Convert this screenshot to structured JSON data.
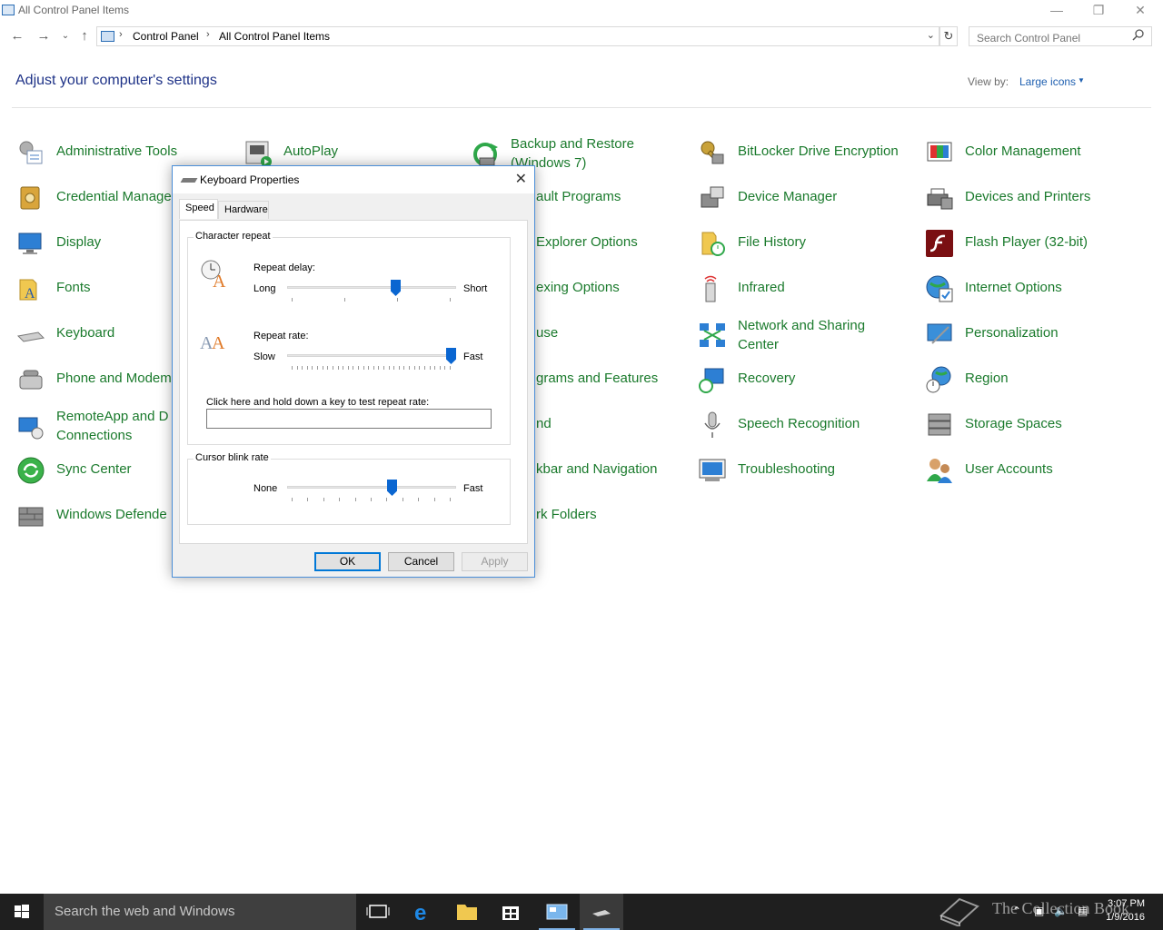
{
  "window": {
    "title": "All Control Panel Items"
  },
  "address": {
    "crumbs": [
      "Control Panel",
      "All Control Panel Items"
    ],
    "search_placeholder": "Search Control Panel"
  },
  "header": {
    "title": "Adjust your computer's settings",
    "view_by_label": "View by:",
    "view_by_value": "Large icons"
  },
  "items": [
    [
      "Administrative Tools",
      "AutoPlay",
      "Backup and Restore\n(Windows 7)",
      "BitLocker Drive Encryption",
      "Color Management"
    ],
    [
      "Credential Manager",
      "ault Programs",
      "Device Manager",
      "Devices and Printers"
    ],
    [
      "Display",
      "Explorer Options",
      "File History",
      "Flash Player (32-bit)"
    ],
    [
      "Fonts",
      "exing Options",
      "Infrared",
      "Internet Options"
    ],
    [
      "Keyboard",
      "use",
      "Network and Sharing\nCenter",
      "Personalization"
    ],
    [
      "Phone and Modem",
      "grams and Features",
      "Recovery",
      "Region"
    ],
    [
      "RemoteApp and D\nConnections",
      "nd",
      "Speech Recognition",
      "Storage Spaces"
    ],
    [
      "Sync Center",
      "kbar and Navigation",
      "Troubleshooting",
      "User Accounts"
    ],
    [
      "Windows Defende",
      "rk Folders"
    ]
  ],
  "labels": {
    "administrative_tools": "Administrative Tools",
    "autoplay": "AutoPlay",
    "backup_1": "Backup and Restore",
    "backup_2": "(Windows 7)",
    "bitlocker": "BitLocker Drive Encryption",
    "color_management": "Color Management",
    "credential_manager": "Credential Manage",
    "default_programs": "ault Programs",
    "device_manager": "Device Manager",
    "devices_printers": "Devices and Printers",
    "display": "Display",
    "explorer_options": "Explorer Options",
    "file_history": "File History",
    "flash_player": "Flash Player (32-bit)",
    "fonts": "Fonts",
    "indexing_options": "exing Options",
    "infrared": "Infrared",
    "internet_options": "Internet Options",
    "keyboard": "Keyboard",
    "mouse": "use",
    "network_1": "Network and Sharing",
    "network_2": "Center",
    "personalization": "Personalization",
    "phone_modem": "Phone and Modem",
    "programs_features": "grams and Features",
    "recovery": "Recovery",
    "region": "Region",
    "remoteapp_1": "RemoteApp and D",
    "remoteapp_2": "Connections",
    "sound": "nd",
    "speech_recognition": "Speech Recognition",
    "storage_spaces": "Storage Spaces",
    "sync_center": "Sync Center",
    "taskbar_navigation": "kbar and Navigation",
    "troubleshooting": "Troubleshooting",
    "user_accounts": "User Accounts",
    "windows_defender": "Windows Defende",
    "work_folders": "rk Folders"
  },
  "dialog": {
    "title": "Keyboard Properties",
    "tabs": [
      "Speed",
      "Hardware"
    ],
    "active_tab": "Speed",
    "character_repeat": {
      "group_label": "Character repeat",
      "repeat_delay_label": "Repeat delay:",
      "delay_min": "Long",
      "delay_max": "Short",
      "delay_value": 0.65,
      "repeat_rate_label": "Repeat rate:",
      "rate_min": "Slow",
      "rate_max": "Fast",
      "rate_value": 1.0,
      "test_label": "Click here and hold down a key to test repeat rate:",
      "test_value": ""
    },
    "cursor_blink": {
      "group_label": "Cursor blink rate",
      "min": "None",
      "max": "Fast",
      "value": 0.63
    },
    "buttons": {
      "ok": "OK",
      "cancel": "Cancel",
      "apply": "Apply"
    }
  },
  "taskbar": {
    "search_placeholder": "Search the web and Windows",
    "time": "3:07 PM",
    "date": "1/9/2016",
    "watermark": "The Collection Book"
  },
  "colors": {
    "link_green": "#1a7a2c",
    "heading_blue": "#1e3287",
    "accent": "#0078d7"
  }
}
